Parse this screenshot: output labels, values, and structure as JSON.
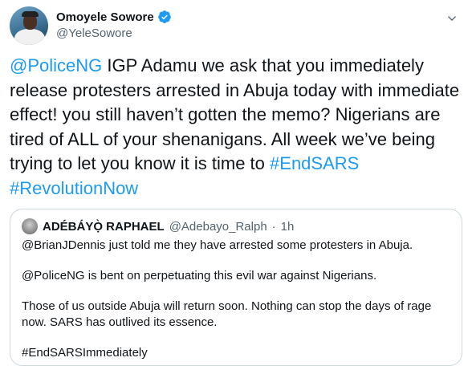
{
  "author": {
    "name": "Omoyele Sowore",
    "handle": "@YeleSowore",
    "verified": true
  },
  "tweet": {
    "mention": "@PoliceNG",
    "text_main": " IGP Adamu we ask that you immediately release protesters arrested in Abuja today with immediate effect! you still haven’t gotten the memo? Nigerians are tired of ALL of your shenanigans. All week we’ve being trying to let you know it is time to ",
    "hashtag_1": "#EndSARS",
    "space": " ",
    "hashtag_2": "#RevolutionNow"
  },
  "quoted_tweet": {
    "name": "ADÉBÁYỌ̀ RAPHAEL",
    "handle": "@Adebayo_Ralph",
    "separator": "·",
    "time": "1h",
    "paragraphs": [
      "@BrianJDennis just told me they have arrested some protesters in Abuja.",
      "@PoliceNG is bent on perpetuating this evil war against Nigerians.",
      "Those of us outside Abuja will return soon. Nothing can stop the days of rage now. SARS has outlived its essence.",
      "#EndSARSImmediately"
    ]
  },
  "icons": {
    "verified": "verified-badge-icon",
    "more": "chevron-down-icon"
  },
  "colors": {
    "link": "#1d9bf0",
    "secondary_text": "#536471",
    "border": "#cfd9de"
  }
}
